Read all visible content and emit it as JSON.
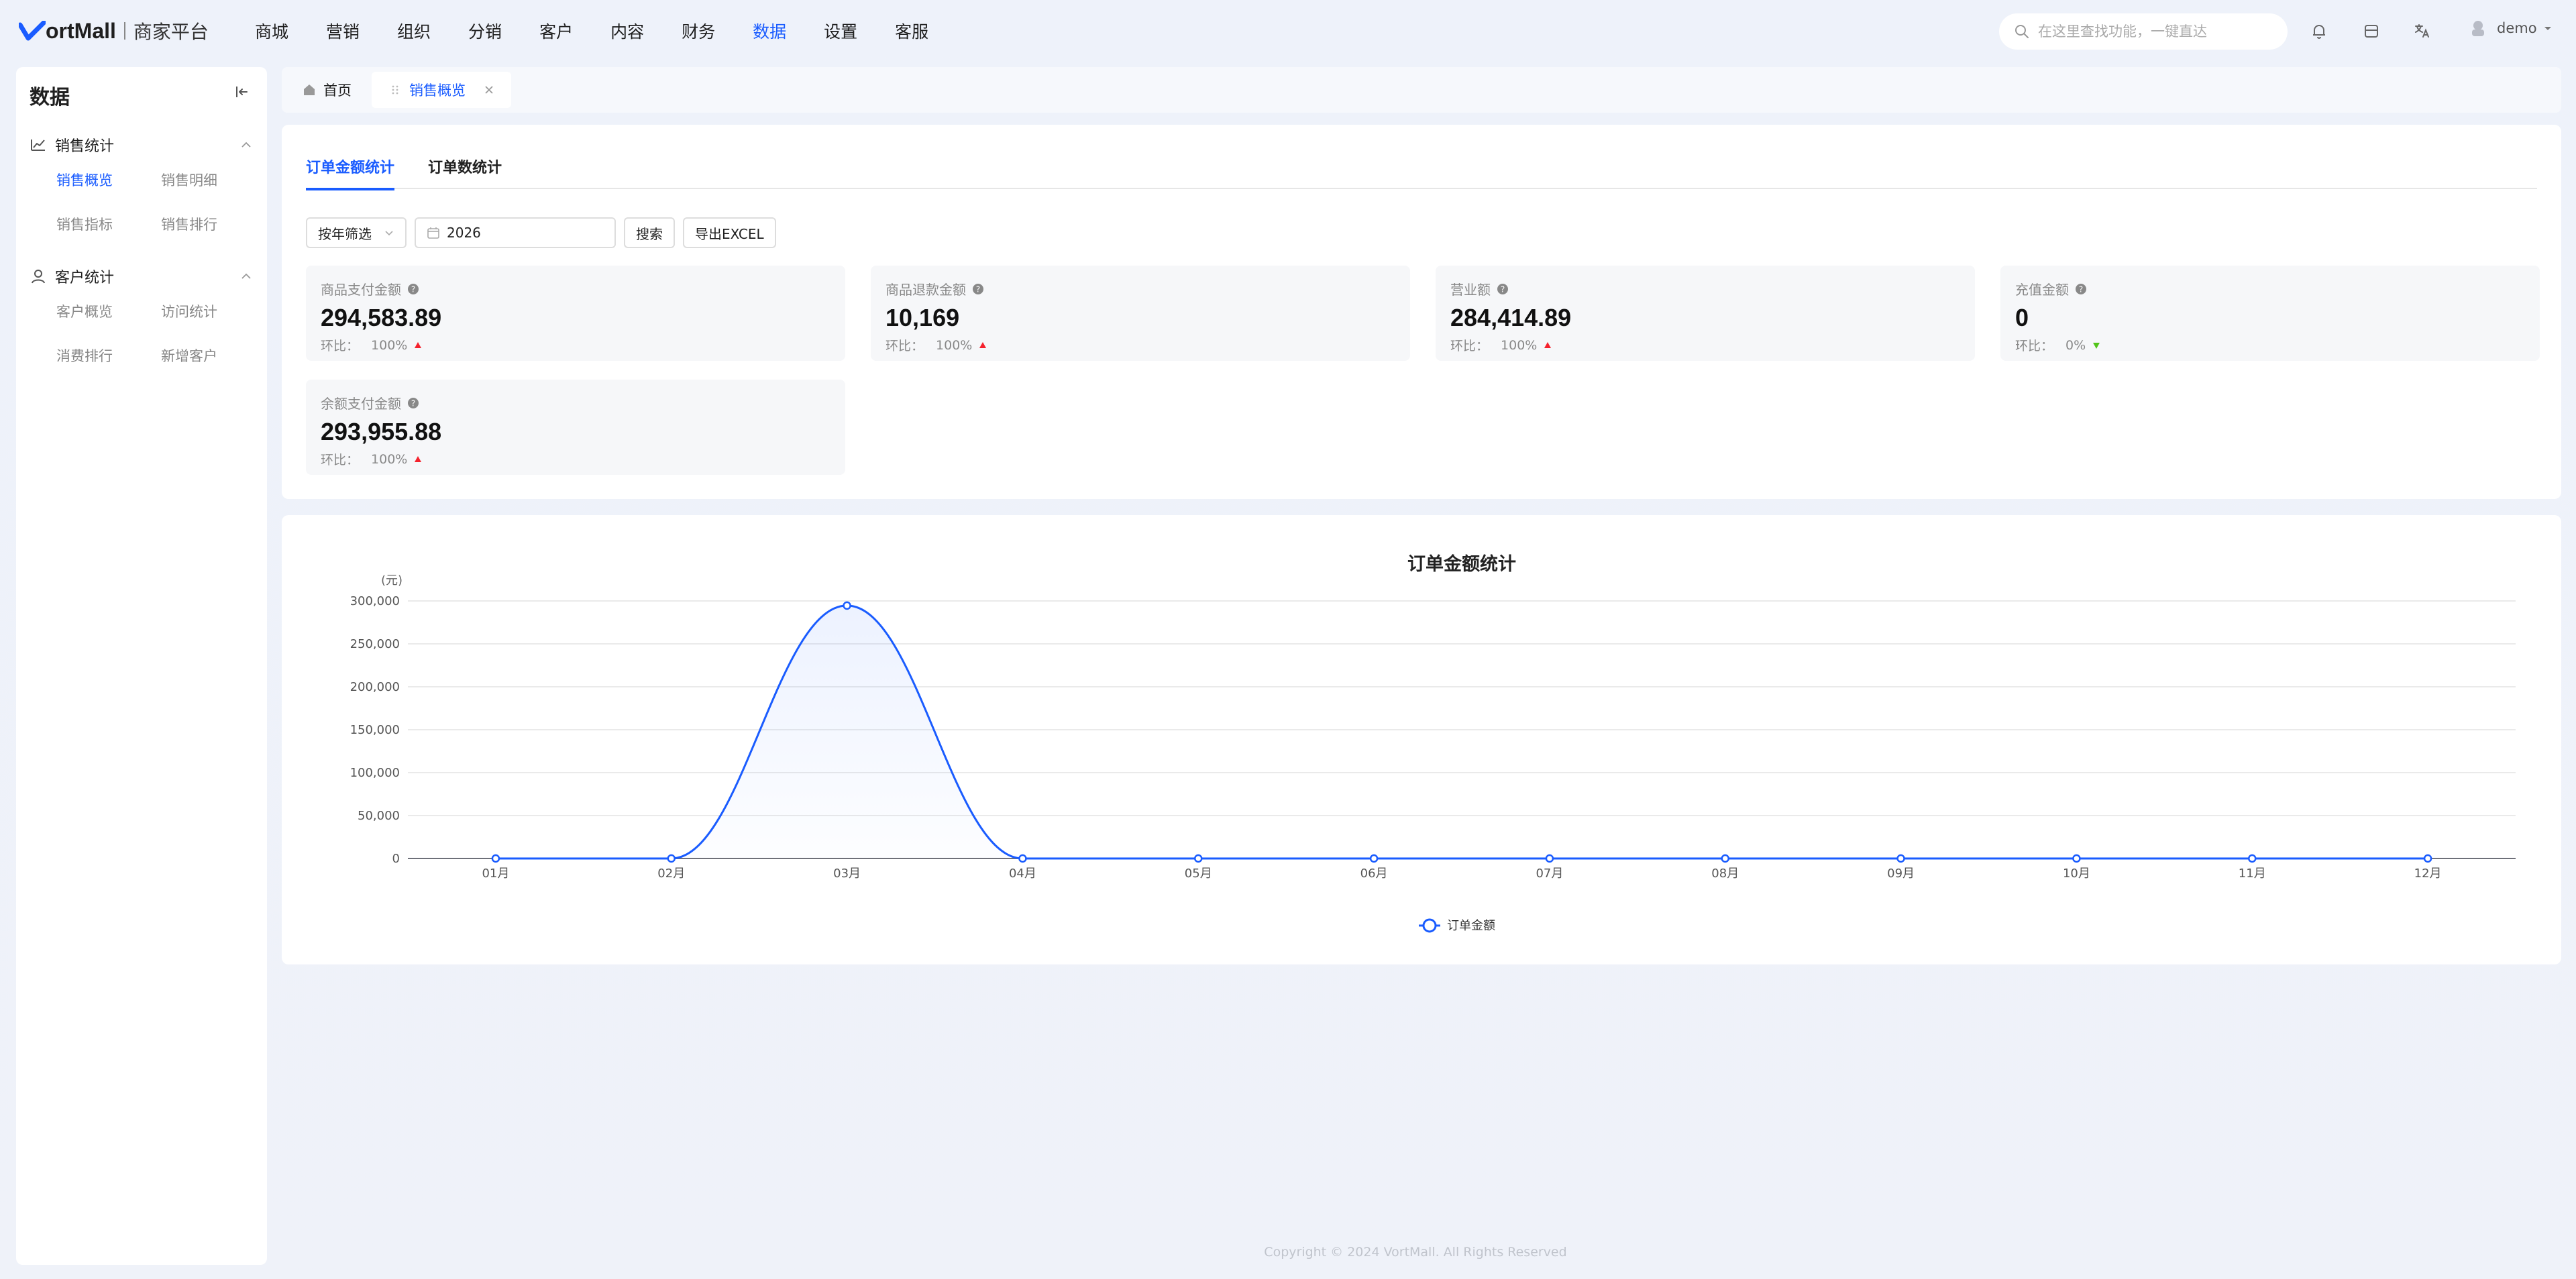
{
  "brand": {
    "logo_text": "ortMall",
    "subtitle": "商家平台"
  },
  "nav": [
    "商城",
    "营销",
    "组织",
    "分销",
    "客户",
    "内容",
    "财务",
    "数据",
    "设置",
    "客服"
  ],
  "nav_active_index": 7,
  "search": {
    "placeholder": "在这里查找功能，一键直达"
  },
  "header_icons": [
    "bell-icon",
    "store-icon",
    "translate-icon"
  ],
  "user": {
    "name": "demo"
  },
  "sidebar": {
    "title": "数据",
    "groups": [
      {
        "label": "销售统计",
        "icon": "chart-line-icon",
        "items": [
          "销售概览",
          "销售明细",
          "销售指标",
          "销售排行"
        ],
        "active": 0
      },
      {
        "label": "客户统计",
        "icon": "user-icon",
        "items": [
          "客户概览",
          "访问统计",
          "消费排行",
          "新增客户"
        ],
        "active": -1
      }
    ]
  },
  "page_tabs": [
    {
      "label": "首页",
      "icon": "home-icon"
    },
    {
      "label": "销售概览",
      "active": true
    }
  ],
  "sub_tabs": [
    {
      "label": "订单金额统计",
      "active": true
    },
    {
      "label": "订单数统计"
    }
  ],
  "filters": {
    "mode_select": "按年筛选",
    "year": "2026",
    "search_button": "搜索",
    "export_button": "导出EXCEL"
  },
  "metrics": [
    {
      "label": "商品支付金额",
      "value": "294,583.89",
      "ratio_label": "环比：",
      "ratio": "100%",
      "trend": "up"
    },
    {
      "label": "商品退款金额",
      "value": "10,169",
      "ratio_label": "环比：",
      "ratio": "100%",
      "trend": "up"
    },
    {
      "label": "营业额",
      "value": "284,414.89",
      "ratio_label": "环比：",
      "ratio": "100%",
      "trend": "up"
    },
    {
      "label": "充值金额",
      "value": "0",
      "ratio_label": "环比：",
      "ratio": "0%",
      "trend": "down"
    },
    {
      "label": "余额支付金额",
      "value": "293,955.88",
      "ratio_label": "环比：",
      "ratio": "100%",
      "trend": "up"
    }
  ],
  "colors": {
    "accent": "#1a5cff",
    "up": "#f5222d",
    "down": "#52c41a"
  },
  "chart_data": {
    "type": "line",
    "title": "订单金额统计",
    "ylabel": "(元)",
    "xlabel": "",
    "categories": [
      "01月",
      "02月",
      "03月",
      "04月",
      "05月",
      "06月",
      "07月",
      "08月",
      "09月",
      "10月",
      "11月",
      "12月"
    ],
    "series": [
      {
        "name": "订单金额",
        "values": [
          0,
          0,
          294583.89,
          0,
          0,
          0,
          0,
          0,
          0,
          0,
          0,
          0
        ],
        "color": "#1a5cff"
      }
    ],
    "ylim": [
      0,
      300000
    ],
    "yticks": [
      "0",
      "50,000",
      "100,000",
      "150,000",
      "200,000",
      "250,000",
      "300,000"
    ],
    "smooth": true,
    "grid": true,
    "legend": "bottom-center"
  },
  "footer": "Copyright © 2024 VortMall. All Rights Reserved"
}
